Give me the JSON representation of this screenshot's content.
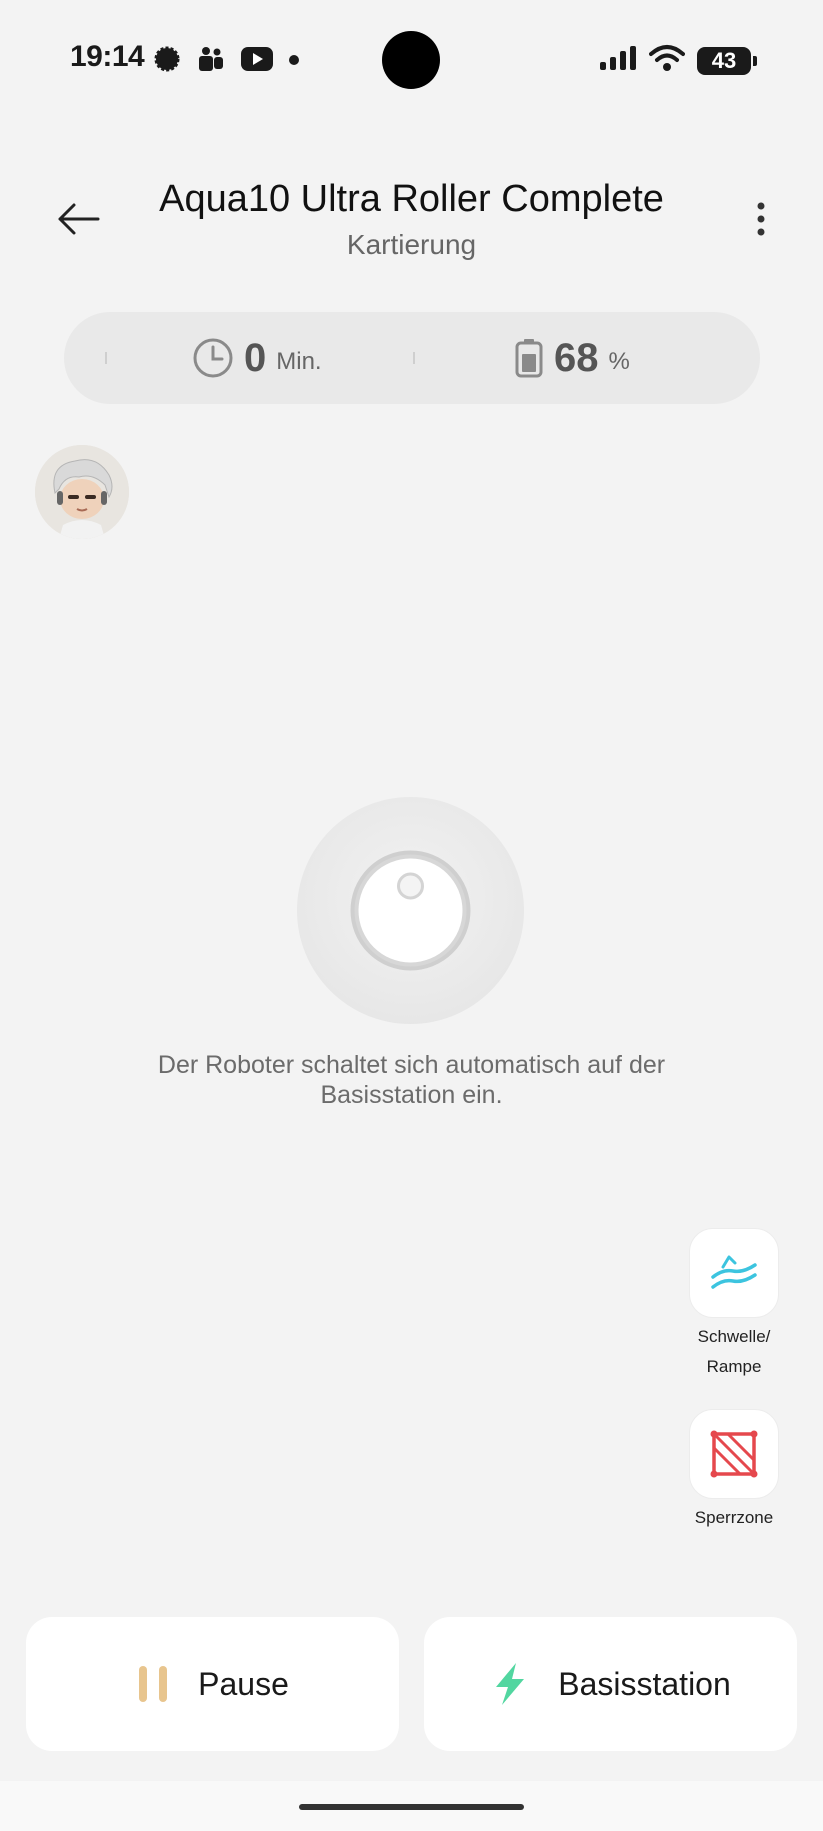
{
  "status_bar": {
    "time": "19:14",
    "battery": "43",
    "icons_left": [
      "signal-app-icon",
      "teams-icon",
      "youtube-icon",
      "dot-icon"
    ],
    "icons_right": [
      "cellular-signal-icon",
      "wifi-icon",
      "battery-icon"
    ]
  },
  "header": {
    "title": "Aqua10 Ultra Roller Complete",
    "subtitle": "Kartierung",
    "back_icon": "arrow-left-icon",
    "menu_icon": "more-vertical-icon"
  },
  "stats": {
    "time_value": "0",
    "time_unit": "Min.",
    "battery_value": "68",
    "battery_unit": "%"
  },
  "robot": {
    "message": "Der Roboter schaltet sich automatisch auf der Basisstation ein."
  },
  "side_actions": [
    {
      "label_line1": "Schwelle/",
      "label_line2": "Rampe",
      "icon": "threshold-ramp-icon",
      "color": "#3cc4df"
    },
    {
      "label": "Sperrzone",
      "icon": "no-go-zone-icon",
      "color": "#e5484d"
    }
  ],
  "bottom_actions": {
    "pause_label": "Pause",
    "pause_color": "#e8c58e",
    "dock_label": "Basisstation",
    "dock_color": "#52d6a0"
  }
}
